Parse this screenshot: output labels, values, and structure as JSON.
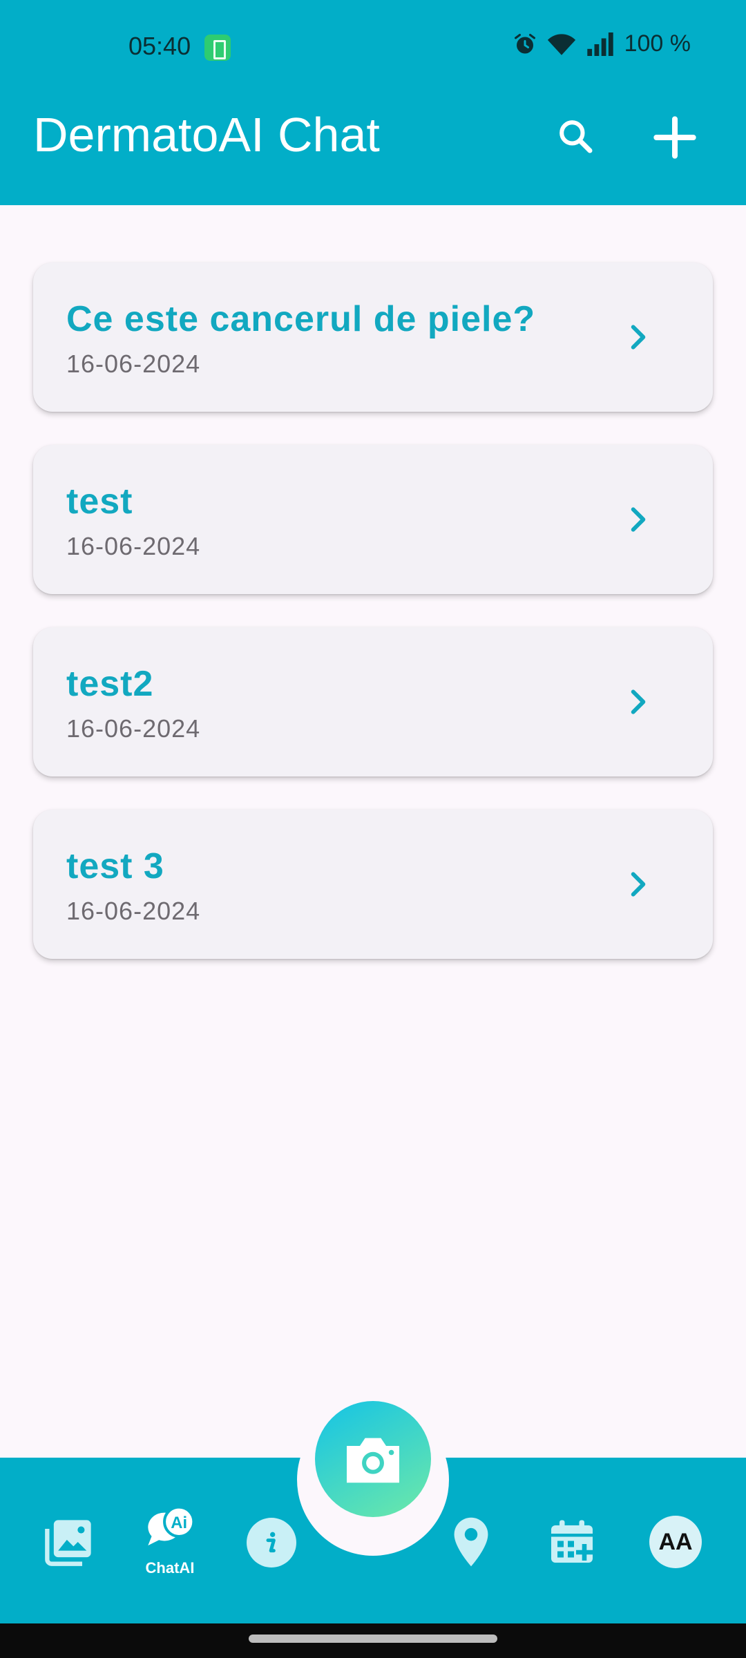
{
  "status_bar": {
    "time": "05:40",
    "battery_text": "100 %",
    "icons": [
      "battery-saver-icon",
      "alarm-icon",
      "wifi-icon",
      "signal-icon"
    ]
  },
  "app_bar": {
    "title": "DermatoAI Chat",
    "actions": [
      "search-icon",
      "add-icon"
    ]
  },
  "chats": [
    {
      "title": "Ce este cancerul de piele?",
      "date": "16-06-2024"
    },
    {
      "title": "test",
      "date": "16-06-2024"
    },
    {
      "title": "test2",
      "date": "16-06-2024"
    },
    {
      "title": "test 3",
      "date": "16-06-2024"
    }
  ],
  "bottom_nav": {
    "items": [
      {
        "icon": "gallery-icon"
      },
      {
        "icon": "chat-ai-icon",
        "label": "ChatAI",
        "badge": "Ai"
      },
      {
        "icon": "info-icon"
      },
      {
        "icon": "camera-icon"
      },
      {
        "icon": "location-icon"
      },
      {
        "icon": "calendar-add-icon"
      },
      {
        "icon": "avatar",
        "text": "AA"
      }
    ]
  },
  "colors": {
    "primary": "#02aec8",
    "accent_text": "#12a8c0",
    "background": "#fcf7fc",
    "card": "#f3f1f6"
  }
}
